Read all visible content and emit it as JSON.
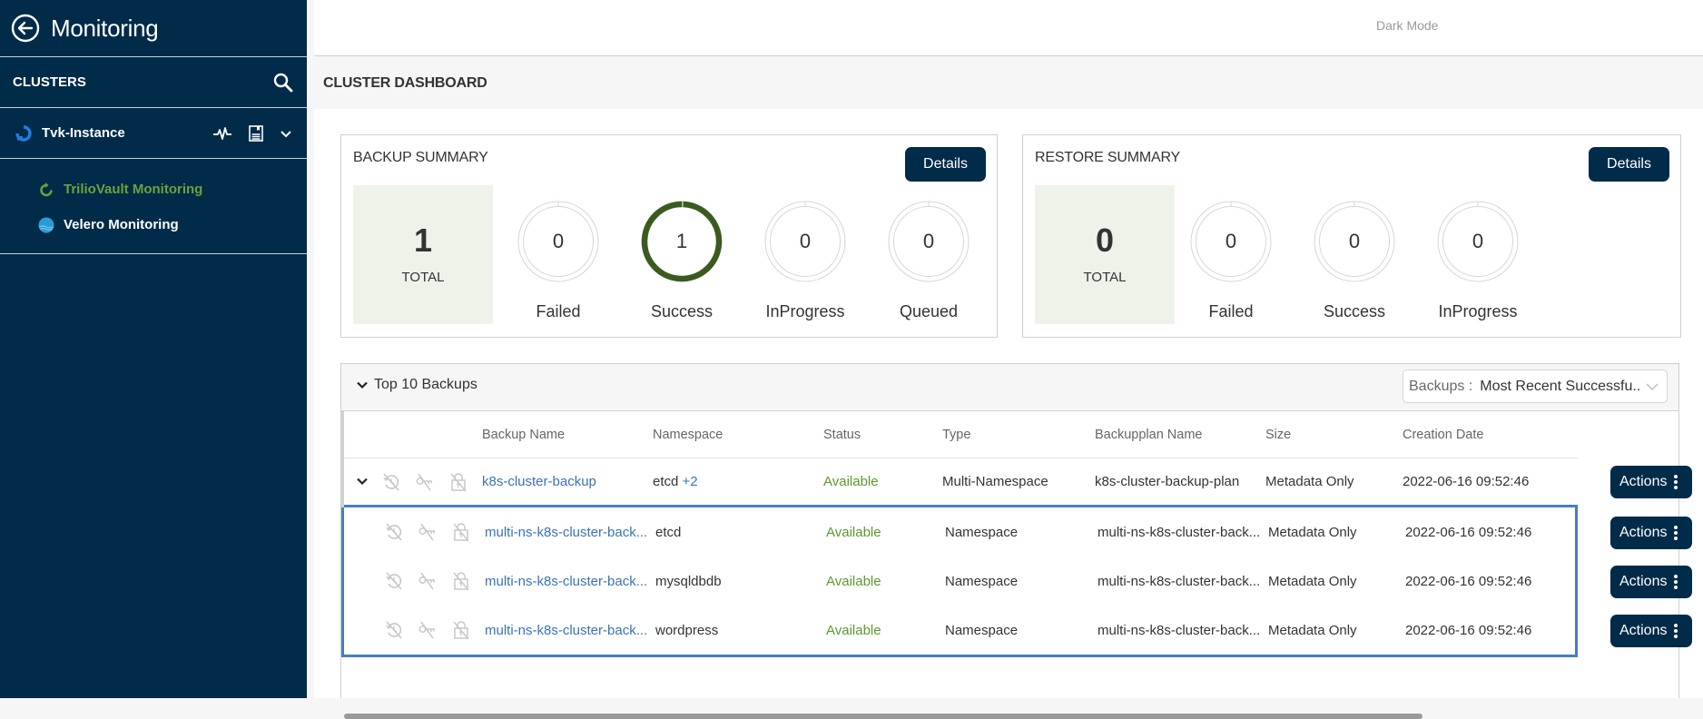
{
  "sidebar": {
    "title": "Monitoring",
    "section_label": "CLUSTERS",
    "instance": {
      "name": "Tvk-Instance"
    },
    "items": [
      {
        "label": "TrilioVault Monitoring",
        "icon": "trilio-refresh-icon",
        "active": true
      },
      {
        "label": "Velero Monitoring",
        "icon": "velero-icon",
        "active": false
      }
    ]
  },
  "topbar": {
    "dark_mode_label": "Dark Mode"
  },
  "page": {
    "title": "CLUSTER DASHBOARD"
  },
  "colors": {
    "sidebar_bg": "#002B49",
    "accent_green": "#6ca13c",
    "success_ring": "#3b5a1f",
    "link_blue": "#3a73b8",
    "button_navy": "#002B49"
  },
  "backup_summary": {
    "title": "BACKUP SUMMARY",
    "details_label": "Details",
    "total": {
      "value": "1",
      "label": "TOTAL"
    },
    "stats": [
      {
        "label": "Failed",
        "value": "0",
        "fill": 0
      },
      {
        "label": "Success",
        "value": "1",
        "fill": 1
      },
      {
        "label": "InProgress",
        "value": "0",
        "fill": 0
      },
      {
        "label": "Queued",
        "value": "0",
        "fill": 0
      }
    ]
  },
  "restore_summary": {
    "title": "RESTORE SUMMARY",
    "details_label": "Details",
    "total": {
      "value": "0",
      "label": "TOTAL"
    },
    "stats": [
      {
        "label": "Failed",
        "value": "0",
        "fill": 0
      },
      {
        "label": "Success",
        "value": "0",
        "fill": 0
      },
      {
        "label": "InProgress",
        "value": "0",
        "fill": 0
      }
    ]
  },
  "top_backups": {
    "title": "Top 10 Backups",
    "filter": {
      "label": "Backups :",
      "value": "Most Recent Successfu..."
    },
    "columns": [
      "Backup Name",
      "Namespace",
      "Status",
      "Type",
      "Backupplan Name",
      "Size",
      "Creation Date"
    ],
    "actions_label": "Actions",
    "parent": {
      "name": "k8s-cluster-backup",
      "namespace": "etcd",
      "namespace_extra": "+2",
      "status": "Available",
      "type": "Multi-Namespace",
      "plan": "k8s-cluster-backup-plan",
      "size": "Metadata Only",
      "date": "2022-06-16 09:52:46"
    },
    "children": [
      {
        "name": "multi-ns-k8s-cluster-back...",
        "namespace": "etcd",
        "status": "Available",
        "type": "Namespace",
        "plan": "multi-ns-k8s-cluster-back...",
        "size": "Metadata Only",
        "date": "2022-06-16 09:52:46"
      },
      {
        "name": "multi-ns-k8s-cluster-back...",
        "namespace": "mysqldbdb",
        "status": "Available",
        "type": "Namespace",
        "plan": "multi-ns-k8s-cluster-back...",
        "size": "Metadata Only",
        "date": "2022-06-16 09:52:46"
      },
      {
        "name": "multi-ns-k8s-cluster-back...",
        "namespace": "wordpress",
        "status": "Available",
        "type": "Namespace",
        "plan": "multi-ns-k8s-cluster-back...",
        "size": "Metadata Only",
        "date": "2022-06-16 09:52:46"
      }
    ]
  }
}
